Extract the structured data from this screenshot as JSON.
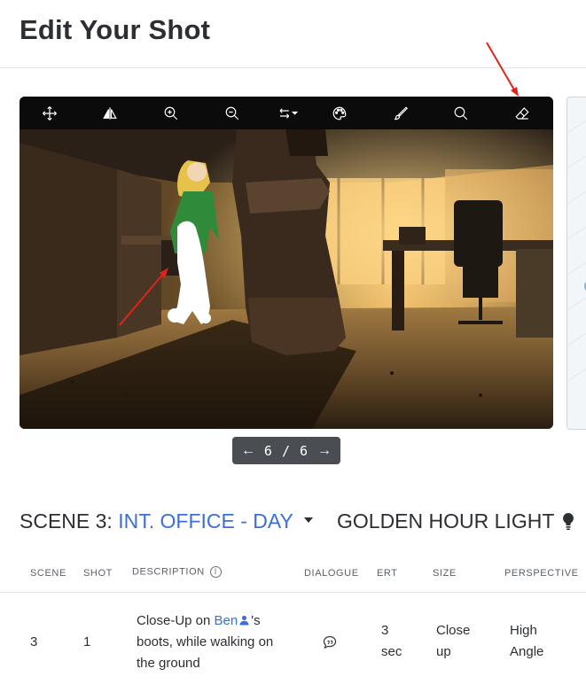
{
  "page": {
    "title": "Edit Your Shot"
  },
  "toolbar": {
    "tools": [
      "move-icon",
      "flip-icon",
      "zoom-in-icon",
      "zoom-out-icon",
      "swap-icon",
      "palette-icon",
      "brush-icon",
      "search-icon",
      "eraser-icon"
    ]
  },
  "pager": {
    "prev": "←",
    "count": "6 / 6",
    "next": "→"
  },
  "scene": {
    "prefix": "SCENE 3:",
    "name": "INT. OFFICE - DAY",
    "lighting": "GOLDEN HOUR LIGHT"
  },
  "table": {
    "headers": {
      "scene": "SCENE",
      "shot": "SHOT",
      "description": "DESCRIPTION",
      "dialogue": "DIALOGUE",
      "ert": "ERT",
      "size": "SIZE",
      "perspective": "PERSPECTIVE"
    },
    "rows": [
      {
        "scene": "3",
        "shot": "1",
        "desc_before": "Close-Up on",
        "desc_character": "Ben",
        "desc_after": "'s boots, while walking on the ground",
        "ert_line1": "3",
        "ert_line2": "sec",
        "size_line1": "Close",
        "size_line2": "up",
        "perspective_line1": "High",
        "perspective_line2": "Angle"
      }
    ]
  },
  "colors": {
    "accent": "#3b6fd6",
    "annotation": "#e0241b",
    "toolbar_bg": "#0b0b0b"
  }
}
